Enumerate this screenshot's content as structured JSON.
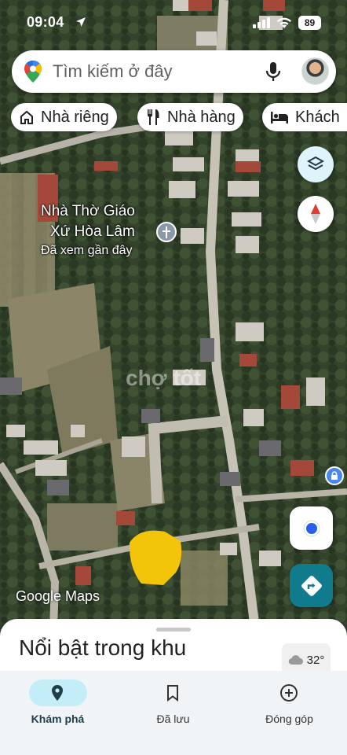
{
  "status_bar": {
    "time": "09:04",
    "battery": "89"
  },
  "search": {
    "placeholder": "Tìm kiếm ở đây"
  },
  "chips": [
    {
      "label": "Nhà riêng",
      "icon": "home-icon"
    },
    {
      "label": "Nhà hàng",
      "icon": "restaurant-icon"
    },
    {
      "label": "Khách",
      "icon": "hotel-icon"
    }
  ],
  "map": {
    "place": {
      "name_line1": "Nhà Thờ Giáo",
      "name_line2": "Xứ Hòa Lâm",
      "subtitle": "Đã xem gần đây",
      "icon": "church-icon"
    },
    "attribution": "Google Maps",
    "watermark": "chợ tốt"
  },
  "sheet": {
    "title": "Nổi bật trong khu vực",
    "temperature": "32°"
  },
  "nav": [
    {
      "label": "Khám phá",
      "icon": "explore-pin-icon",
      "active": true
    },
    {
      "label": "Đã lưu",
      "icon": "bookmark-icon",
      "active": false
    },
    {
      "label": "Đóng góp",
      "icon": "add-circle-icon",
      "active": false
    }
  ],
  "colors": {
    "accent": "#0f7b8d",
    "active_pill": "#c4eef7",
    "highlight_area": "#f2c40a"
  }
}
